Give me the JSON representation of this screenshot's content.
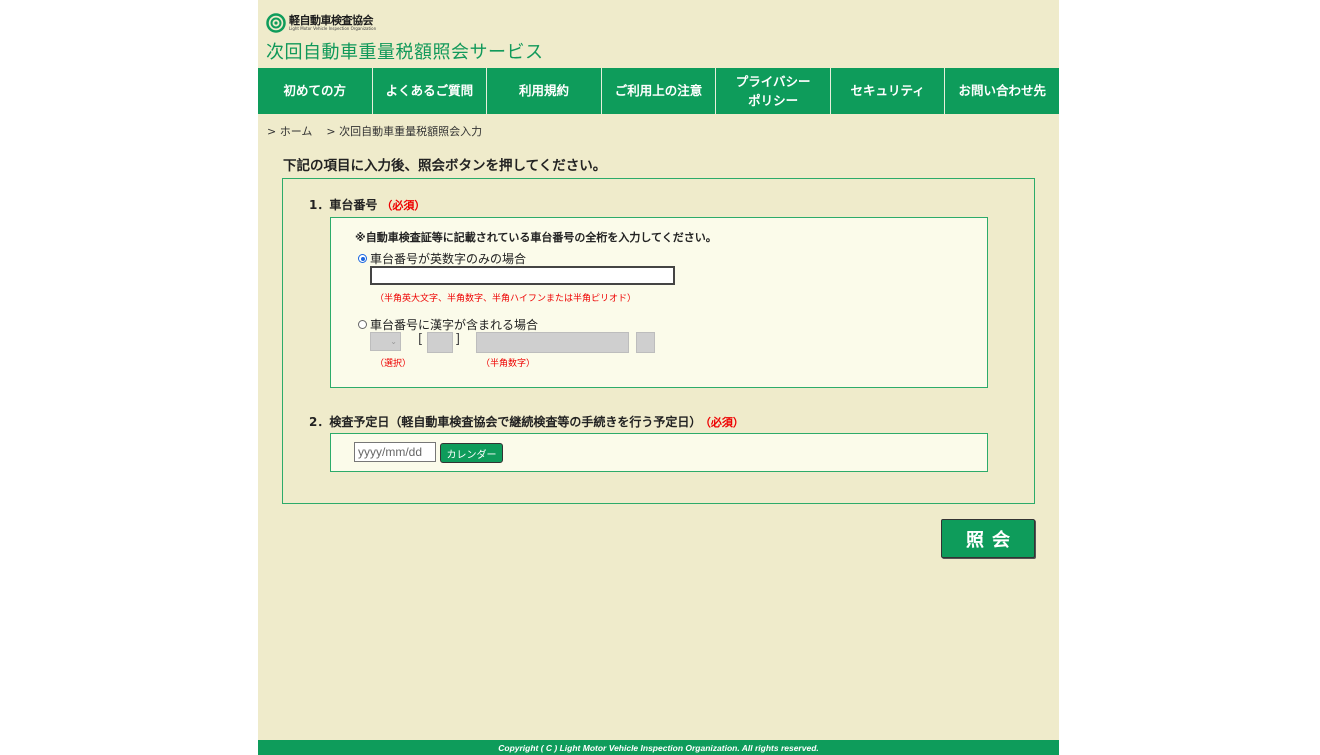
{
  "header": {
    "logo_jp": "軽自動車検査協会",
    "logo_en": "Light Motor Vehicle Inspection Organization",
    "service_title": "次回自動車重量税額照会サービス"
  },
  "nav": {
    "items": [
      {
        "label": "初めての方"
      },
      {
        "label": "よくあるご質問"
      },
      {
        "label": "利用規約"
      },
      {
        "label": "ご利用上の注意"
      },
      {
        "label": "プライバシー\nポリシー"
      },
      {
        "label": "セキュリティ"
      },
      {
        "label": "お問い合わせ先"
      }
    ]
  },
  "breadcrumb": {
    "home": "> ホーム",
    "current": "> 次回自動車重量税額照会入力"
  },
  "instruction": "下記の項目に入力後、照会ボタンを押してください。",
  "form": {
    "section1": {
      "label": "1．車台番号",
      "required": "（必須）",
      "note": "※自動車検査証等に記載されている車台番号の全桁を入力してください。",
      "option_alnum": "車台番号が英数字のみの場合",
      "option_alnum_value": "",
      "hint_alnum": "（半角英大文字、半角数字、半角ハイフンまたは半角ピリオド）",
      "option_kanji": "車台番号に漢字が含まれる場合",
      "hint_select": "（選択）",
      "hint_digits": "（半角数字）",
      "bracket_open": "[",
      "bracket_close": "]",
      "selected_option": "alnum"
    },
    "section2": {
      "label": "2．検査予定日（軽自動車検査協会で継続検査等の手続きを行う予定日）",
      "required": "（必須）",
      "date_placeholder": "yyyy/mm/dd",
      "calendar_label": "カレンダー"
    },
    "submit_label": "照会"
  },
  "footer": {
    "copyright": "Copyright ( C ) Light Motor Vehicle Inspection Organization. All rights reserved."
  },
  "colors": {
    "brand_green": "#0e9c5b",
    "page_bg": "#efebcb",
    "required_red": "#e00000"
  }
}
